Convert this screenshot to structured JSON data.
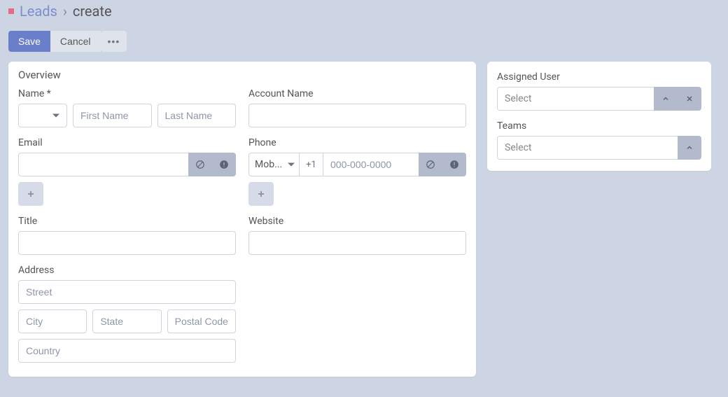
{
  "breadcrumb": {
    "link": "Leads",
    "separator": "›",
    "current": "create"
  },
  "actions": {
    "save": "Save",
    "cancel": "Cancel"
  },
  "overview": {
    "header": "Overview",
    "name": {
      "label": "Name *",
      "first_placeholder": "First Name",
      "last_placeholder": "Last Name"
    },
    "account": {
      "label": "Account Name"
    },
    "email": {
      "label": "Email"
    },
    "phone": {
      "label": "Phone",
      "type": "Mob...",
      "cc": "+1",
      "placeholder": "000-000-0000"
    },
    "title": {
      "label": "Title"
    },
    "website": {
      "label": "Website"
    },
    "address": {
      "label": "Address",
      "street": "Street",
      "city": "City",
      "state": "State",
      "postal": "Postal Code",
      "country": "Country"
    }
  },
  "side": {
    "assigned_user": {
      "label": "Assigned User",
      "placeholder": "Select"
    },
    "teams": {
      "label": "Teams",
      "placeholder": "Select"
    }
  }
}
